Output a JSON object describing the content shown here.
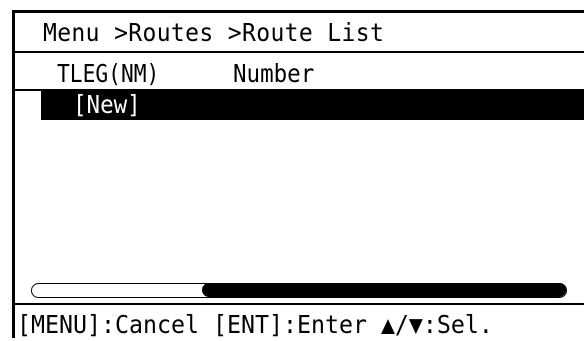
{
  "header": {
    "breadcrumb": "Menu >Routes >Route List"
  },
  "table": {
    "columns": [
      "TLEG(NM)",
      "Number"
    ],
    "rows": [
      {
        "label": "[New]",
        "selected": true
      }
    ]
  },
  "scrollbar": {
    "visible": true
  },
  "footer": {
    "hint": "[MENU]:Cancel [ENT]:Enter ▲/▼:Sel."
  },
  "colors": {
    "background": "#ffffff",
    "foreground": "#000000",
    "selection": "#000000"
  }
}
